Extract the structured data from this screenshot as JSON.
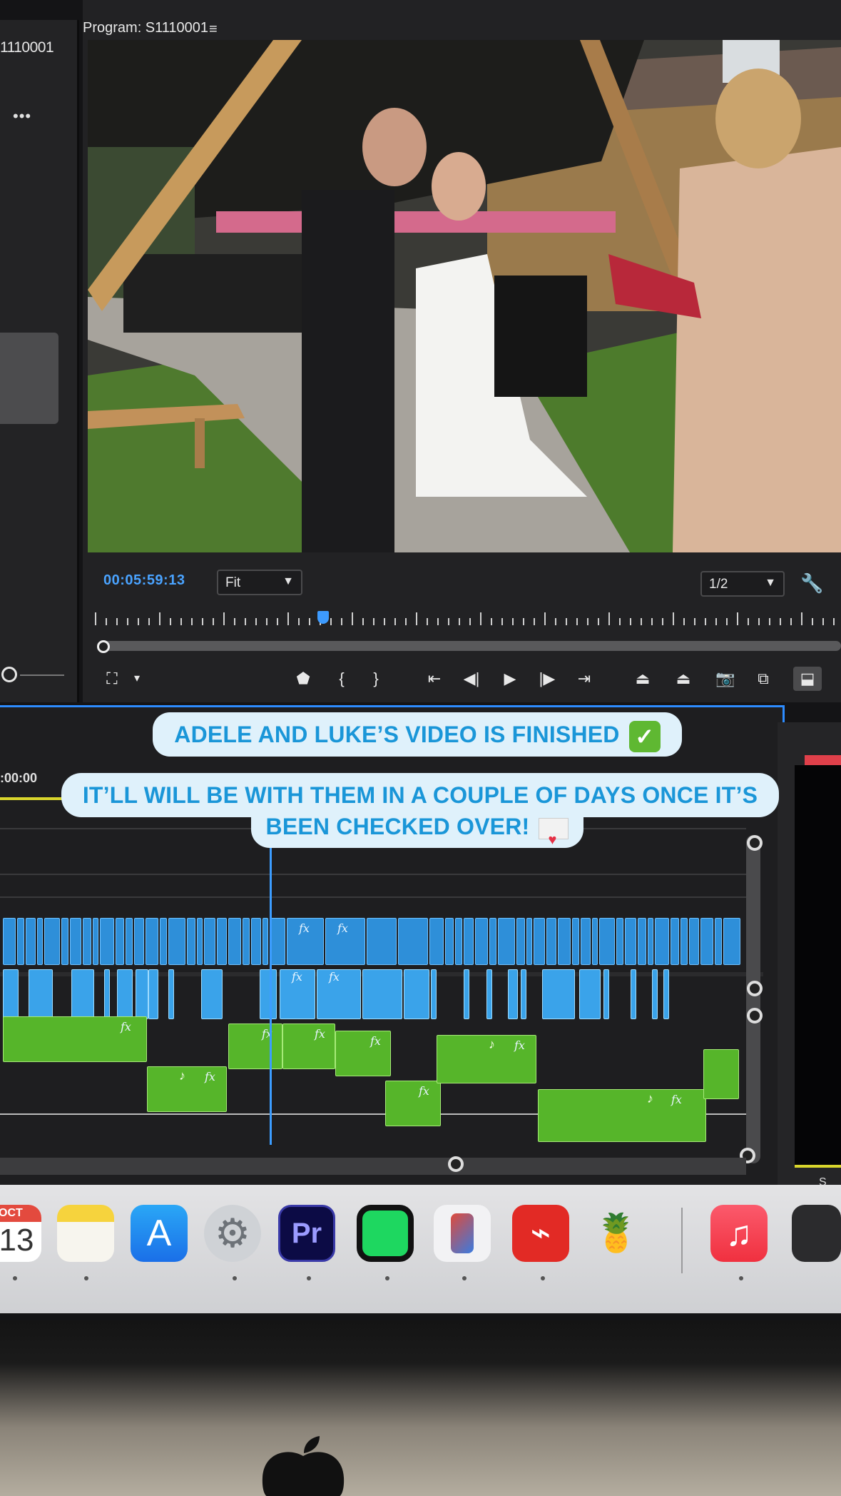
{
  "program_monitor": {
    "title": "Program: S1110001",
    "menu_icon": "≡",
    "timecode": "00:05:59:13",
    "fit": "Fit",
    "resolution": "1/2",
    "chevron": "⌄"
  },
  "source_monitor": {
    "title": "1110001",
    "more": "•••"
  },
  "timeline": {
    "timecode": ":00:00",
    "fx_label": "fx",
    "note_label": "♪"
  },
  "captions": {
    "line1": "ADELE AND LUKE’S VIDEO IS FINISHED",
    "line2a": "IT’LL WILL BE WITH THEM IN A COUPLE OF DAYS ONCE IT’S",
    "line2b": "BEEN CHECKED OVER!",
    "check_emoji": "✓",
    "heart": "♥"
  },
  "dock": {
    "calendar_month": "OCT",
    "calendar_day": "13",
    "premiere_label": "Pr"
  },
  "right_panel": {
    "label": "S"
  },
  "colors": {
    "accent_blue": "#2d8cff",
    "video_clip": "#2e8fd9",
    "audio_clip": "#56b52a",
    "caption_text": "#1a96d8"
  }
}
